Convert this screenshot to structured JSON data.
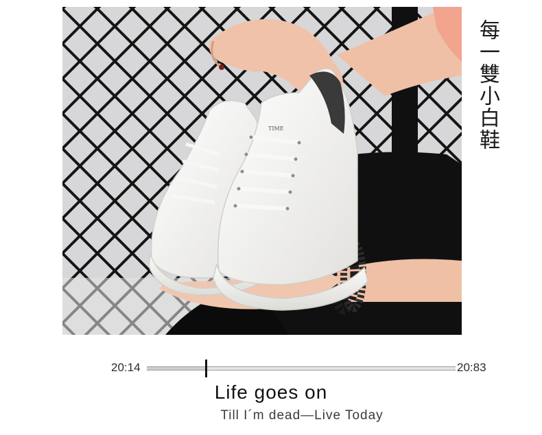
{
  "caption": {
    "vertical_text": "每一雙小白鞋"
  },
  "player": {
    "current_time": "20:14",
    "total_time": "20:83",
    "progress": 0.19
  },
  "text": {
    "title": "Life goes on",
    "subtitle": "Till I´m dead—Live Today"
  },
  "photo": {
    "shoe_tongue_text": "TIME",
    "icons": [
      "white-sneaker-icon",
      "chain-link-fence-icon",
      "beaded-bracelet-icon"
    ],
    "colors": {
      "background_grey": "#c9c9cb",
      "fence": "#141414",
      "sneaker": "#f4f3f1",
      "heel_tab": "#3a3a3a",
      "skin": "#f0c2a9",
      "sleeve": "#f2a48e"
    }
  }
}
